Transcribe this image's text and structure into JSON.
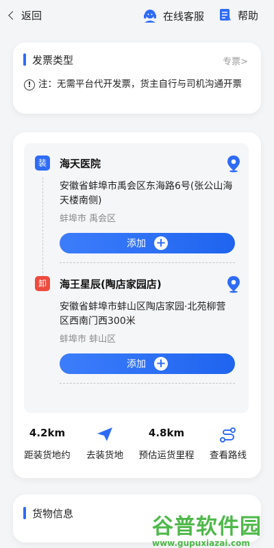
{
  "topbar": {
    "back_label": "返回",
    "service_label": "在线客服",
    "help_label": "帮助"
  },
  "invoice": {
    "title": "发票类型",
    "link": "专票>",
    "note_icon": "!",
    "note": "注：无需平台代开发票，货主自行与司机沟通开票"
  },
  "route": {
    "stops": [
      {
        "tag": "装",
        "name": "海天医院",
        "address": "安徽省蚌埠市禹会区东海路6号(张公山海天楼南侧)",
        "city": "蚌埠市 禹会区",
        "add_label": "添加"
      },
      {
        "tag": "卸",
        "name": "海王星辰(陶店家园店)",
        "address": "安徽省蚌埠市蚌山区陶店家园·北苑柳营区西南门西300米",
        "city": "蚌埠市 蚌山区",
        "add_label": "添加"
      }
    ],
    "stats": {
      "dist_to_load_value": "4.2km",
      "dist_to_load_label": "距装货地约",
      "navigate_label": "去装货地",
      "est_value": "4.8km",
      "est_label": "预估运货里程",
      "view_route_label": "查看路线"
    }
  },
  "goods": {
    "title": "货物信息"
  },
  "watermark": {
    "cn": "谷普软件园",
    "en": "www.gupuxiazai.com"
  },
  "colors": {
    "accent": "#2f6cf6",
    "unload_tag": "#ee4b3f",
    "page_bg": "#f4f5f7"
  }
}
